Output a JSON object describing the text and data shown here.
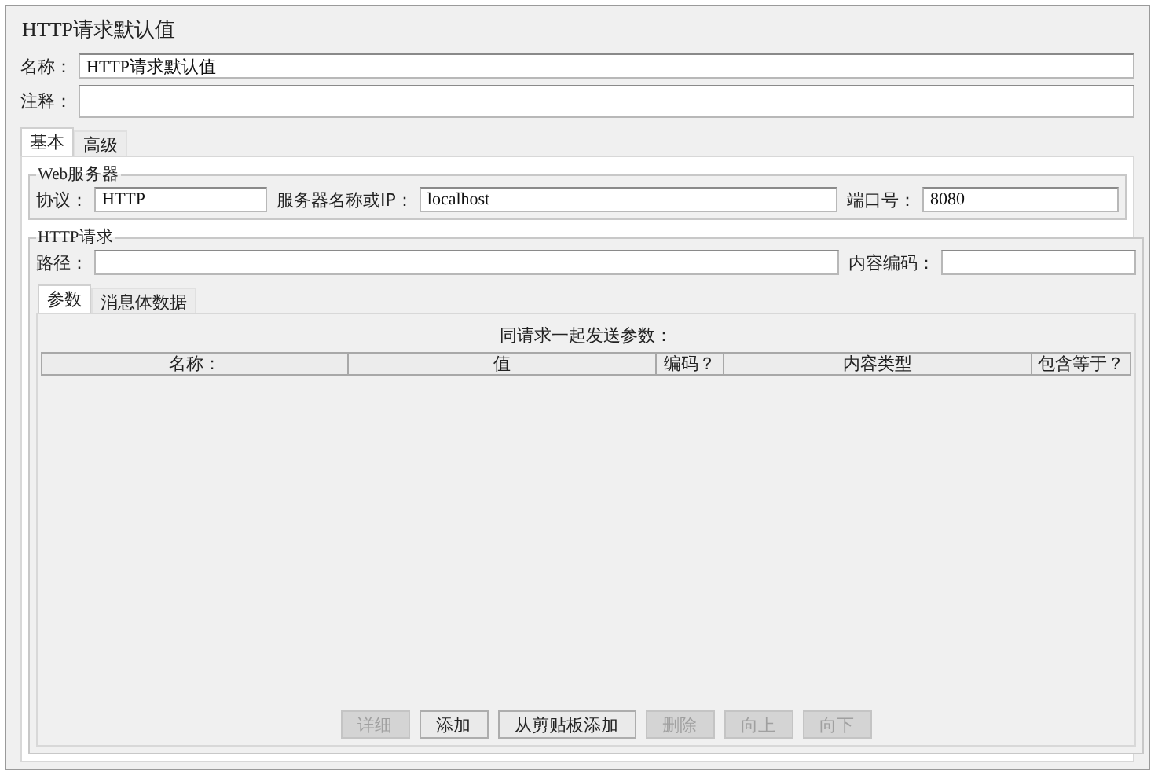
{
  "title": "HTTP请求默认值",
  "name_field": {
    "label": "名称：",
    "value": "HTTP请求默认值"
  },
  "comment_field": {
    "label": "注释："
  },
  "tabs": [
    {
      "label": "基本",
      "selected": true
    },
    {
      "label": "高级",
      "selected": false
    }
  ],
  "web_server": {
    "legend": "Web服务器",
    "protocol": {
      "label": "协议：",
      "value": "HTTP"
    },
    "server": {
      "label": "服务器名称或IP：",
      "value": "localhost"
    },
    "port": {
      "label": "端口号：",
      "value": "8080"
    }
  },
  "http_request": {
    "legend": "HTTP请求",
    "path": {
      "label": "路径："
    },
    "encoding": {
      "label": "内容编码："
    },
    "tabs": [
      {
        "label": "参数",
        "selected": true
      },
      {
        "label": "消息体数据",
        "selected": false
      }
    ],
    "table": {
      "caption": "同请求一起发送参数：",
      "columns": [
        "名称：",
        "值",
        "编码？",
        "内容类型",
        "包含等于？"
      ]
    }
  },
  "buttons": [
    {
      "label": "详细",
      "disabled": true
    },
    {
      "label": "添加",
      "disabled": false
    },
    {
      "label": "从剪贴板添加",
      "disabled": false
    },
    {
      "label": "删除",
      "disabled": true
    },
    {
      "label": "向上",
      "disabled": true
    },
    {
      "label": "向下",
      "disabled": true
    }
  ]
}
